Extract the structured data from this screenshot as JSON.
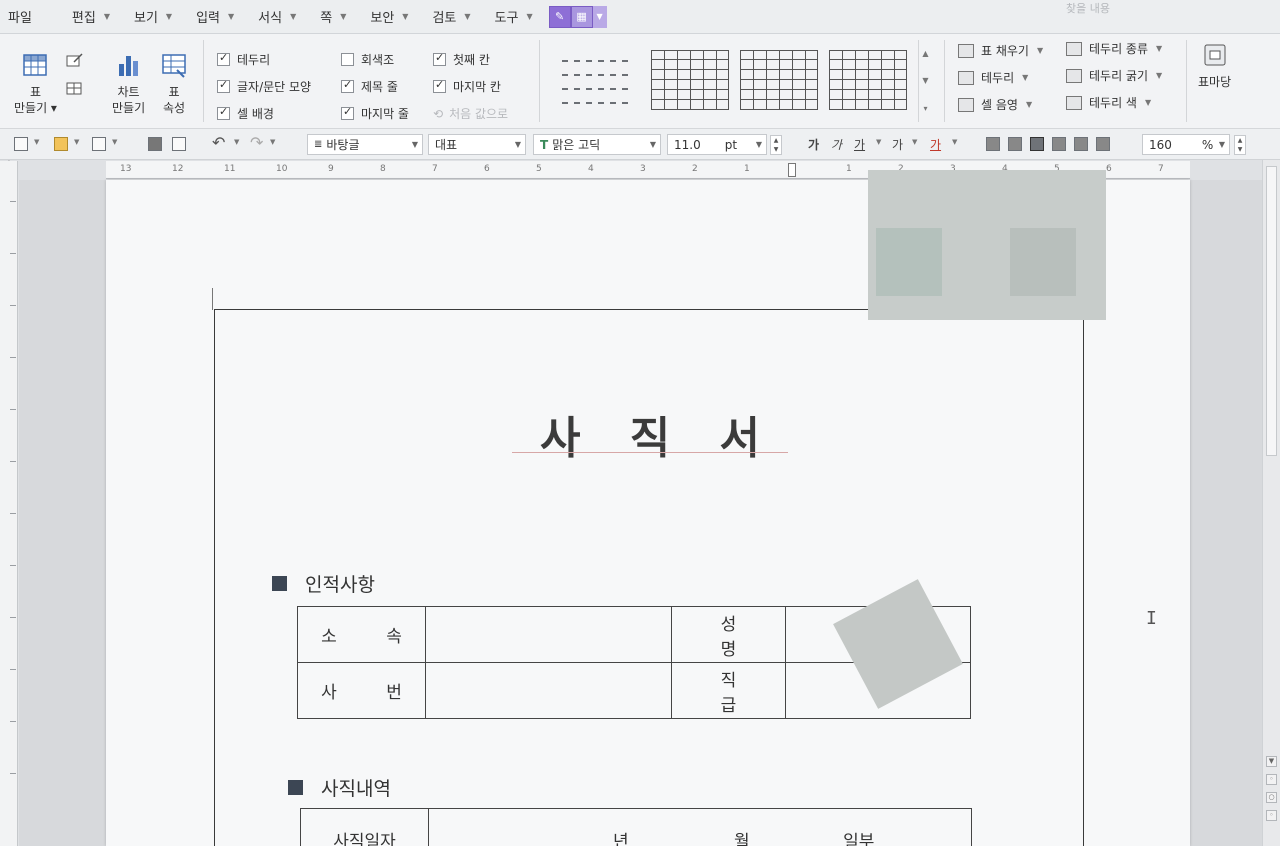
{
  "menu": {
    "items": [
      {
        "label": "파일",
        "caret": false
      },
      {
        "label": "편집",
        "caret": true
      },
      {
        "label": "보기",
        "caret": true
      },
      {
        "label": "입력",
        "caret": true
      },
      {
        "label": "서식",
        "caret": true
      },
      {
        "label": "쪽",
        "caret": true
      },
      {
        "label": "보안",
        "caret": true
      },
      {
        "label": "검토",
        "caret": true
      },
      {
        "label": "도구",
        "caret": true
      }
    ],
    "help_hint": "찾을 내용"
  },
  "ribbon": {
    "table_make": "표\n만들기",
    "chart_make": "차트\n만들기",
    "table_props": "표\n속성",
    "checks": [
      {
        "label": "테두리",
        "checked": true
      },
      {
        "label": "글자/문단 모양",
        "checked": true
      },
      {
        "label": "셀 배경",
        "checked": true
      },
      {
        "label": "회색조",
        "checked": false
      },
      {
        "label": "제목 줄",
        "checked": true
      },
      {
        "label": "마지막 줄",
        "checked": true
      },
      {
        "label": "첫째 칸",
        "checked": true
      },
      {
        "label": "마지막 칸",
        "checked": true
      },
      {
        "label": "처음 값으로",
        "checked": false,
        "disabled": true
      }
    ],
    "fill_label": "표 채우기",
    "border_label": "테두리",
    "shade_label": "셀 음영",
    "border_type_label": "테두리 종류",
    "border_width_label": "테두리 굵기",
    "border_color_label": "테두리 색",
    "table_label": "표마당"
  },
  "toolbar": {
    "style": "바탕글",
    "lang": "대표",
    "font": "맑은 고딕",
    "font_size": "11.0",
    "unit": "pt",
    "zoom": "160",
    "zoom_unit": "%",
    "fmt_labels": [
      "가",
      "가",
      "가",
      "가",
      "가"
    ]
  },
  "ruler": {
    "marks": [
      "13",
      "12",
      "11",
      "10",
      "9",
      "8",
      "7",
      "6",
      "5",
      "4",
      "3",
      "2",
      "1",
      "1",
      "2",
      "3",
      "4",
      "5",
      "6",
      "7"
    ]
  },
  "document": {
    "title": "사 직 서",
    "section1": "인적사항",
    "section2": "사직내역",
    "table1": [
      [
        "소 속",
        "",
        "성 명",
        ""
      ],
      [
        "사 번",
        "",
        "직 급",
        ""
      ]
    ],
    "table2_row": [
      "사직일자",
      "년",
      "월",
      "일부"
    ]
  }
}
